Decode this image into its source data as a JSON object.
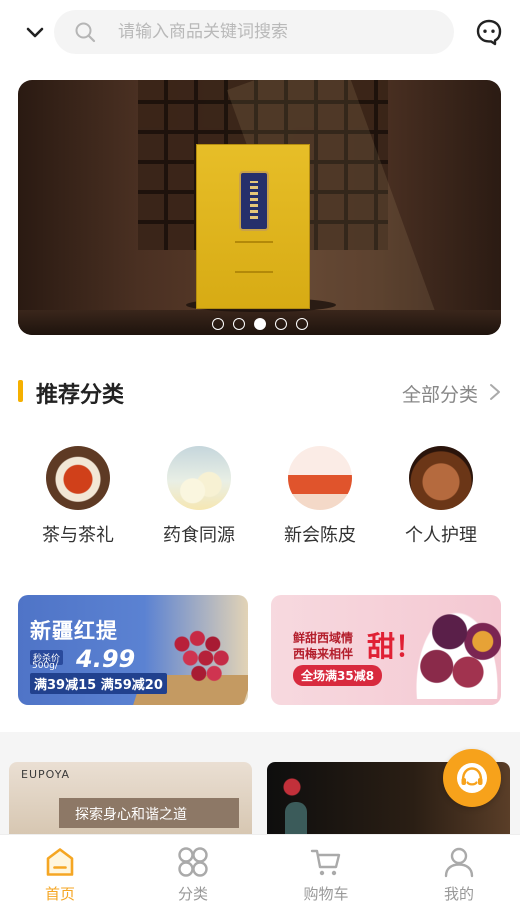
{
  "search": {
    "placeholder": "请输入商品关键词搜索"
  },
  "banner": {
    "page_count": 5,
    "active_index": 2
  },
  "section": {
    "title": "推荐分类",
    "more": "全部分类"
  },
  "categories": [
    {
      "label": "茶与茶礼"
    },
    {
      "label": "药食同源"
    },
    {
      "label": "新会陈皮"
    },
    {
      "label": "个人护理"
    }
  ],
  "promos": {
    "left": {
      "title": "新疆红提",
      "tag": "秒杀价",
      "weight": "500g/",
      "price": "4.99",
      "deal": "满39减15 满59减20"
    },
    "right": {
      "line1": "鲜甜西域情",
      "line2": "西梅来相伴",
      "sweet": "甜！",
      "deal": "全场满35减8"
    }
  },
  "products": [
    {
      "brand": "EUPOYA",
      "slogan": "探索身心和谐之道"
    },
    {
      "brand": ""
    }
  ],
  "tabs": [
    {
      "label": "首页"
    },
    {
      "label": "分类"
    },
    {
      "label": "购物车"
    },
    {
      "label": "我的"
    }
  ],
  "colors": {
    "accent": "#f5a623",
    "section_bar": "#f5b000",
    "inactive": "#999999"
  },
  "icons": {
    "top_left": "chevron-down-icon",
    "search": "search-icon",
    "top_right": "message-icon",
    "fab": "customer-service-icon"
  }
}
